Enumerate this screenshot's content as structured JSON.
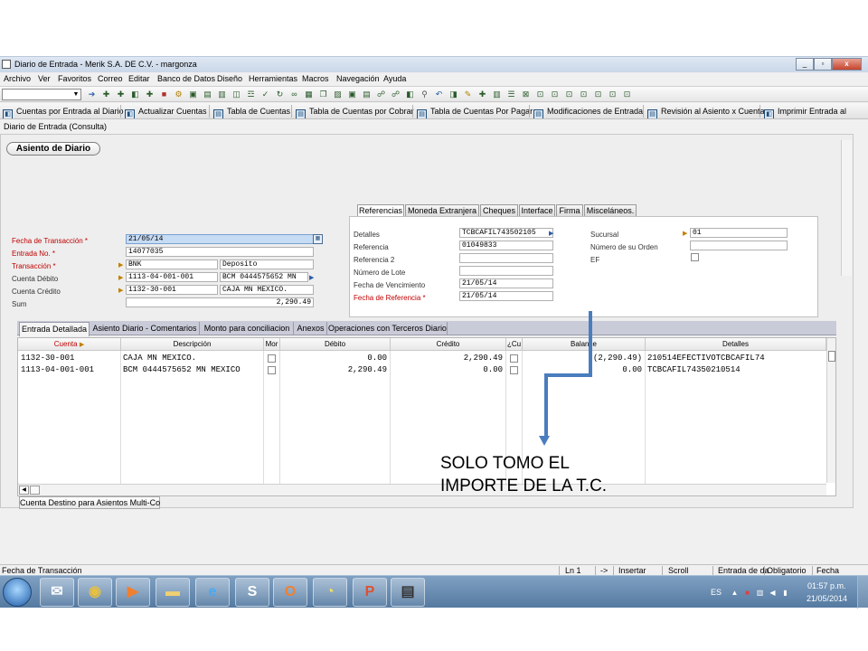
{
  "window": {
    "title": "Diario de Entrada - Merik S.A. DE C.V. - margonza",
    "controls": [
      "_",
      "▫",
      "x"
    ]
  },
  "menu": [
    "Archivo",
    "Ver",
    "Favoritos",
    "Correo",
    "Editar",
    "Banco de Datos",
    "Diseño",
    "Herramientas",
    "Macros",
    "Navegación",
    "Ayuda"
  ],
  "linkbar": [
    "Cuentas por Entrada al Diario",
    "Actualizar Cuentas",
    "Tabla de Cuentas",
    "Tabla de Cuentas por Cobrar",
    "Tabla de Cuentas Por Pagar",
    "Modificaciones de Entrada",
    "Revisión al Asiento x Cuenta",
    "Imprimir Entrada al"
  ],
  "subtitle": "Diario de Entrada (Consulta)",
  "asiento_tab": "Asiento de Diario",
  "left_form": {
    "fecha_label": "Fecha de Transacción *",
    "fecha_value": "21/05/14",
    "entrada_label": "Entrada No. *",
    "entrada_value": "14077035",
    "transaccion_label": "Transacción *",
    "transaccion_code": "BNK",
    "transaccion_desc": "Deposito",
    "debito_label": "Cuenta Débito",
    "debito_code": "1113-04-001-001",
    "debito_desc": "BCM 0444575652 MN",
    "credito_label": "Cuenta Crédito",
    "credito_code": "1132-30-001",
    "credito_desc": "CAJA MN MEXICO.",
    "sum_label": "Sum",
    "sum_value": "2,290.49"
  },
  "ref_tabs": [
    "Referencias",
    "Moneda Extranjera",
    "Cheques",
    "Interface",
    "Firma",
    "Misceláneos."
  ],
  "ref_form": {
    "detalles_label": "Detalles",
    "detalles_value": "TCBCAFIL743502105",
    "referencia_label": "Referencia",
    "referencia_value": "01049833",
    "referencia2_label": "Referencia 2",
    "referencia2_value": "",
    "lote_label": "Número de Lote",
    "lote_value": "",
    "vencimiento_label": "Fecha de Vencimiento",
    "vencimiento_value": "21/05/14",
    "fecha_ref_label": "Fecha de Referencia *",
    "fecha_ref_value": "21/05/14",
    "sucursal_label": "Sucursal",
    "sucursal_value": "01",
    "orden_label": "Número de su Orden",
    "orden_value": "",
    "ef_label": "EF"
  },
  "grid_tabs": [
    "Entrada Detallada",
    "Asiento Diario - Comentarios",
    "Monto para conciliacion",
    "Anexos",
    "Operaciones con Terceros Diario"
  ],
  "grid": {
    "columns": [
      "Cuenta",
      "Descripción",
      "Mor",
      "Débito",
      "Crédito",
      "¿Cu",
      "Balance",
      "Detalles"
    ],
    "rows": [
      {
        "cuenta": "1132-30-001",
        "descripcion": "CAJA MN MEXICO.",
        "debito": "0.00",
        "credito": "2,290.49",
        "balance": "(2,290.49)",
        "detalles": "210514EFECTIVOTCBCAFIL74"
      },
      {
        "cuenta": "1113-04-001-001",
        "descripcion": "BCM 0444575652 MN MEXICO",
        "debito": "2,290.49",
        "credito": "0.00",
        "balance": "0.00",
        "detalles": "TCBCAFIL74350210514"
      }
    ]
  },
  "bottom_tab": "Cuenta Destino para Asientos Multi-Co",
  "annotation": {
    "line1": "SOLO TOMO EL",
    "line2": "IMPORTE DE LA T.C.",
    "color": "#4a7dbe"
  },
  "statusbar": {
    "field": "Fecha de Transacción",
    "line": "Ln 1",
    "arrow": "->",
    "insert": "Insertar",
    "scroll": "Scroll",
    "entry": "Entrada de da",
    "required": "Obligatorio",
    "type": "Fecha"
  },
  "taskbar": {
    "apps": [
      "Outlook",
      "Chrome",
      "Media",
      "Files",
      "IE",
      "Skype",
      "Office",
      "Clock",
      "PowerPoint",
      "Window"
    ],
    "lang": "ES",
    "time": "01:57 p.m.",
    "date": "21/05/2014"
  }
}
